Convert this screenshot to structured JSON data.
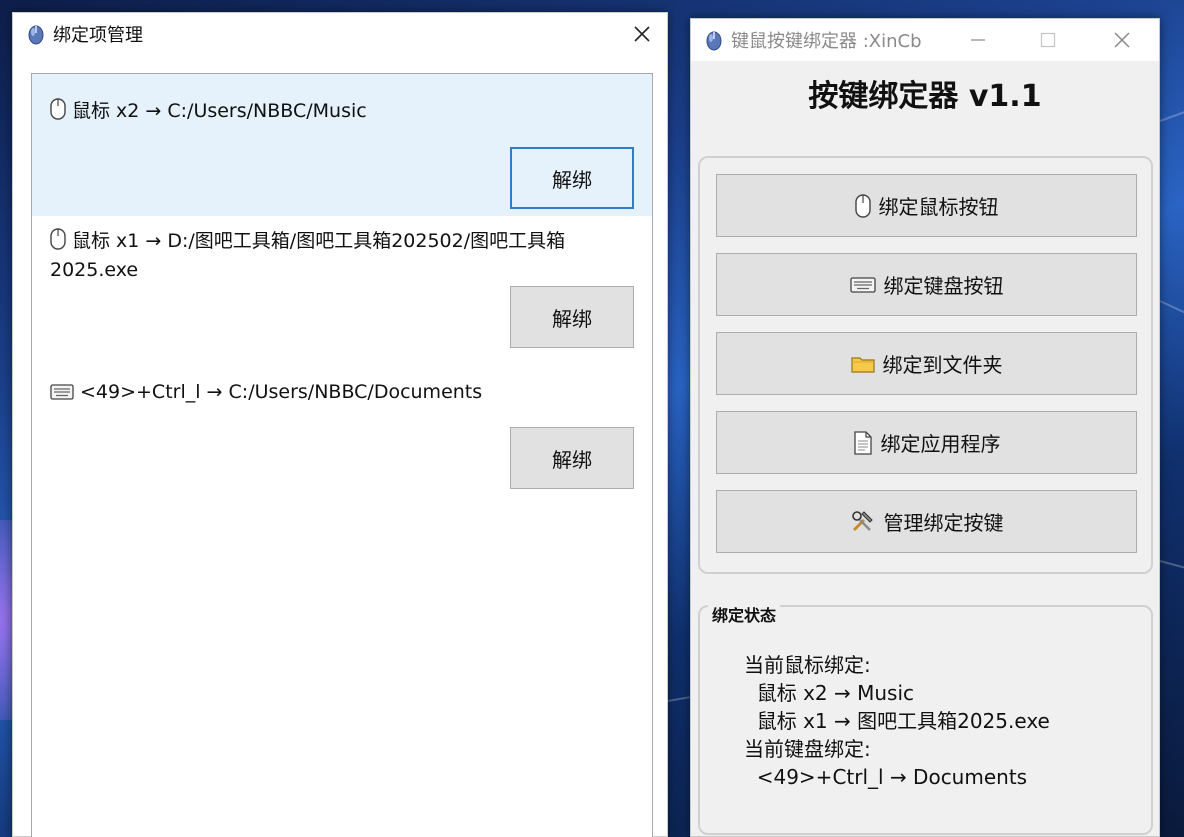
{
  "left_window": {
    "title": "绑定项管理",
    "items": [
      {
        "kind_icon": "mouse-icon",
        "text": "鼠标 x2 → C:/Users/NBBC/Music",
        "button": "解绑",
        "selected": true
      },
      {
        "kind_icon": "mouse-icon",
        "text": "鼠标 x1 → D:/图吧工具箱/图吧工具箱202502/图吧工具箱2025.exe",
        "button": "解绑",
        "selected": false
      },
      {
        "kind_icon": "keyboard-icon",
        "text": "<49>+Ctrl_l → C:/Users/NBBC/Documents",
        "button": "解绑",
        "selected": false
      }
    ]
  },
  "right_window": {
    "title": "键鼠按键绑定器 :XinCb",
    "heading": "按键绑定器 v1.1",
    "buttons": [
      {
        "icon": "mouse-icon",
        "label": "绑定鼠标按钮"
      },
      {
        "icon": "keyboard-icon",
        "label": "绑定键盘按钮"
      },
      {
        "icon": "folder-icon",
        "label": "绑定到文件夹"
      },
      {
        "icon": "document-icon",
        "label": "绑定应用程序"
      },
      {
        "icon": "tools-icon",
        "label": "管理绑定按键"
      }
    ],
    "status": {
      "legend": "绑定状态",
      "lines": [
        "当前鼠标绑定:",
        "  鼠标 x2 → Music",
        "  鼠标 x1 → 图吧工具箱2025.exe",
        "当前键盘绑定:",
        "  <49>+Ctrl_l → Documents"
      ]
    }
  },
  "colors": {
    "selection": "#e5f1fb",
    "focus_border": "#2c7ec9",
    "button_face": "#e1e1e1",
    "window_bg": "#f0f0f0"
  }
}
